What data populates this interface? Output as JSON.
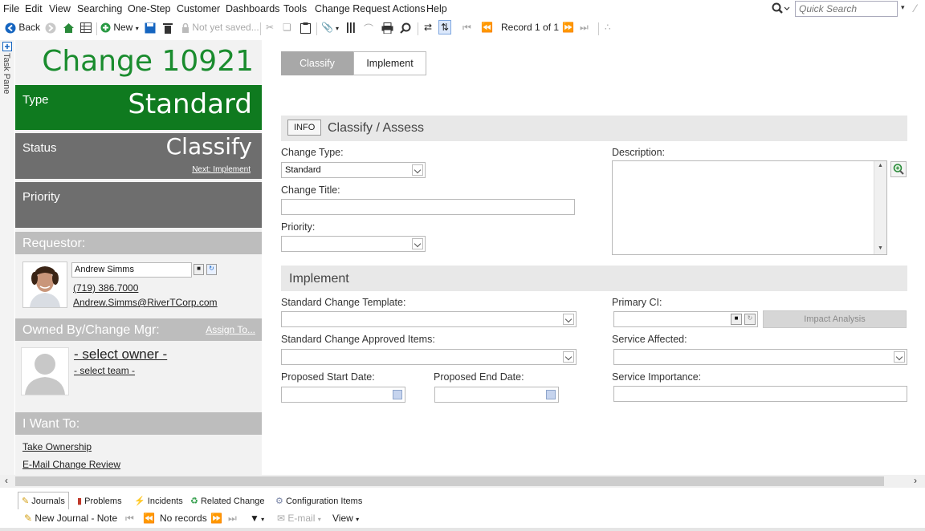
{
  "menu": [
    "File",
    "Edit",
    "View",
    "Searching",
    "One-Step",
    "Customer",
    "Dashboards",
    "Tools",
    "Change Request Actions",
    "Help"
  ],
  "quick_search": {
    "placeholder": "Quick Search"
  },
  "toolbar": {
    "back": "Back",
    "new": "New",
    "not_saved": "Not yet saved...",
    "record": "Record 1 of 1"
  },
  "task_pane": "Task Pane",
  "summary": {
    "title": "Change 10921",
    "type_label": "Type",
    "type_value": "Standard",
    "status_label": "Status",
    "status_value": "Classify",
    "next_link": "Next: Implement",
    "priority_label": "Priority",
    "requestor_label": "Requestor:",
    "requestor_name": "Andrew Simms",
    "requestor_phone": "(719) 386.7000",
    "requestor_email": "Andrew.Simms@RiverTCorp.com",
    "owned_label": "Owned By/Change Mgr:",
    "assign_link": "Assign To...",
    "select_owner": "- select owner -",
    "select_team": "- select team -",
    "iwant_label": "I Want To:",
    "actions": [
      "Take Ownership",
      "E-Mail Change Review"
    ]
  },
  "tabs": {
    "classify": "Classify",
    "implement": "Implement"
  },
  "classify": {
    "info": "INFO",
    "title": "Classify / Assess",
    "change_type_label": "Change Type:",
    "change_type_value": "Standard",
    "change_title_label": "Change Title:",
    "priority_label": "Priority:",
    "description_label": "Description:"
  },
  "implement": {
    "title": "Implement",
    "template_label": "Standard Change Template:",
    "approved_label": "Standard Change Approved Items:",
    "start_label": "Proposed Start Date:",
    "end_label": "Proposed End Date:",
    "primary_ci_label": "Primary CI:",
    "impact_button": "Impact Analysis",
    "service_affected_label": "Service Affected:",
    "service_importance_label": "Service Importance:"
  },
  "bottom_tabs": [
    "Journals",
    "Problems",
    "Incidents",
    "Related Change",
    "Configuration Items"
  ],
  "bottom_toolbar": {
    "new_journal": "New Journal - Note",
    "no_records": "No records",
    "email": "E-mail",
    "view": "View"
  },
  "colors": {
    "green_title": "#1a8c2e",
    "green_block": "#0f7a1f",
    "gray_block": "#6e6e6e",
    "section_head": "#bdbdbd"
  }
}
